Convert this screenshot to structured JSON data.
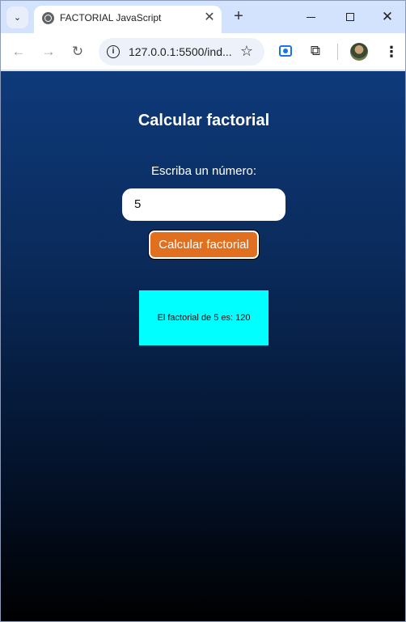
{
  "browser": {
    "tab": {
      "title": "FACTORIAL JavaScript",
      "close_glyph": "✕"
    },
    "new_tab_glyph": "+",
    "tab_search_glyph": "⌄",
    "window_controls": {
      "close_glyph": "✕"
    },
    "toolbar": {
      "back_glyph": "←",
      "forward_glyph": "→",
      "reload_glyph": "↻",
      "url": "127.0.0.1:5500/ind...",
      "star_glyph": "☆",
      "puzzle_glyph": "⧉",
      "menu_glyph": "⋮"
    },
    "icons": {
      "favicon": "globe-icon",
      "info": "info-icon",
      "extension_active": "screen-cast-icon",
      "extensions": "puzzle-icon",
      "profile": "avatar"
    }
  },
  "page": {
    "title": "Calcular factorial",
    "prompt_label": "Escriba un número:",
    "number_input": {
      "value": "5"
    },
    "calc_button_label": "Calcular factorial",
    "result_text": "El factorial de 5 es: 120",
    "colors": {
      "gradient_top": "#0e3a7a",
      "gradient_bottom": "#000000",
      "button": "#e07020",
      "result_box": "#00ffff"
    }
  }
}
